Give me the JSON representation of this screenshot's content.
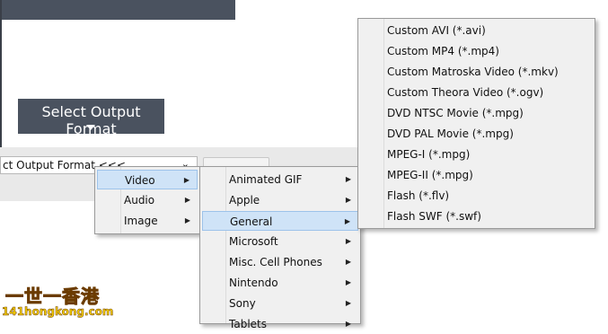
{
  "output_button": {
    "label": "Select Output Format"
  },
  "format_select": {
    "value": "ct Output Format <<<"
  },
  "menu_level1": {
    "items": [
      {
        "label": "Video",
        "has_submenu": true,
        "highlighted": true
      },
      {
        "label": "Audio",
        "has_submenu": true,
        "highlighted": false
      },
      {
        "label": "Image",
        "has_submenu": true,
        "highlighted": false
      }
    ]
  },
  "menu_level2": {
    "items": [
      {
        "label": "Animated GIF",
        "has_submenu": true,
        "highlighted": false
      },
      {
        "label": "Apple",
        "has_submenu": true,
        "highlighted": false
      },
      {
        "label": "General",
        "has_submenu": true,
        "highlighted": true
      },
      {
        "label": "Microsoft",
        "has_submenu": true,
        "highlighted": false
      },
      {
        "label": "Misc. Cell Phones",
        "has_submenu": true,
        "highlighted": false
      },
      {
        "label": "Nintendo",
        "has_submenu": true,
        "highlighted": false
      },
      {
        "label": "Sony",
        "has_submenu": true,
        "highlighted": false
      },
      {
        "label": "Tablets",
        "has_submenu": true,
        "highlighted": false
      }
    ]
  },
  "menu_level3": {
    "items": [
      {
        "label": "Custom AVI (*.avi)"
      },
      {
        "label": "Custom MP4 (*.mp4)"
      },
      {
        "label": "Custom Matroska Video (*.mkv)"
      },
      {
        "label": "Custom Theora Video (*.ogv)"
      },
      {
        "label": "DVD NTSC Movie (*.mpg)"
      },
      {
        "label": "DVD PAL Movie (*.mpg)"
      },
      {
        "label": "MPEG-I (*.mpg)"
      },
      {
        "label": "MPEG-II (*.mpg)"
      },
      {
        "label": "Flash (*.flv)"
      },
      {
        "label": "Flash SWF (*.swf)"
      }
    ]
  },
  "watermark": {
    "line1": "一世一香港",
    "line2": "141hongkong.com"
  },
  "colors": {
    "toolbar_bg": "#4a525f",
    "highlight": "#cfe3f7",
    "menu_bg": "#f0f0f0"
  }
}
